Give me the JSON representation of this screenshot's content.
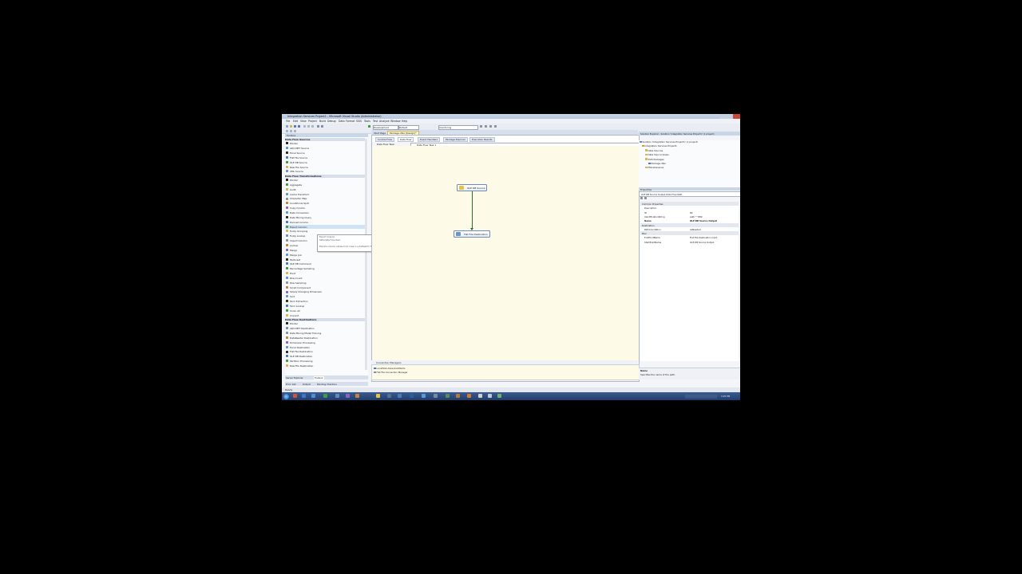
{
  "window": {
    "title": "Integration Services Project1 - Microsoft Visual Studio (Administrator)"
  },
  "menu": [
    "File",
    "Edit",
    "View",
    "Project",
    "Build",
    "Debug",
    "Data",
    "Format",
    "SSIS",
    "Tools",
    "Test",
    "Analyze",
    "Window",
    "Help"
  ],
  "toolbar": {
    "config": "Development",
    "platform": "Default",
    "find": "monitoring"
  },
  "toolbox": {
    "title": "Toolbox",
    "sources_header": "Data Flow Sources",
    "sources": [
      "Pointer",
      "ADO NET Source",
      "Excel Source",
      "Flat File Source",
      "OLE DB Source",
      "Raw File Source",
      "XML Source"
    ],
    "transforms_header": "Data Flow Transformations",
    "transforms": [
      "Pointer",
      "Aggregate",
      "Audit",
      "Cache Transform",
      "Character Map",
      "Conditional Split",
      "Copy Column",
      "Data Conversion",
      "Data Mining Query",
      "Derived Column",
      "Export Column",
      "Fuzzy Grouping",
      "Fuzzy Lookup",
      "Import Column",
      "Lookup",
      "Merge",
      "Merge Join",
      "Multicast",
      "OLE DB Command",
      "Percentage Sampling",
      "Pivot",
      "Row Count",
      "Row Sampling",
      "Script Component",
      "Slowly Changing Dimension",
      "Sort",
      "Term Extraction",
      "Term Lookup",
      "Union All",
      "Unpivot"
    ],
    "destinations_header": "Data Flow Destinations",
    "destinations": [
      "Pointer",
      "ADO NET Destination",
      "Data Mining Model Training",
      "DataReader Destination",
      "Dimension Processing",
      "Excel Destination",
      "Flat File Destination",
      "OLE DB Destination",
      "Partition Processing",
      "Raw File Destination"
    ],
    "bottom_tabs": [
      "Server Explorer",
      "Toolbox"
    ],
    "bottom_tabs2": [
      "Error List",
      "Output",
      "Pending Checkins"
    ]
  },
  "tooltip": {
    "title": "Export Column",
    "version": "SSIS Data Flow Item",
    "desc": "Exports column values from rows in a dataset to files."
  },
  "designer": {
    "doc_tabs": [
      "Start Page",
      "Package.dtsx [Design]*"
    ],
    "tabs": [
      "Control Flow",
      "Data Flow",
      "Event Handlers",
      "Package Explorer",
      "Execution Results"
    ],
    "task_label": "Data Flow Task:",
    "task_value": "Data Flow Task 1",
    "components": {
      "source": "OLE DB Source",
      "dest": "Flat File Destination"
    }
  },
  "connections": {
    "title": "Connection Managers",
    "items": [
      "LocalHost.AdventureWorks",
      "Flat File Connection Manager"
    ]
  },
  "solution": {
    "title": "Solution Explorer - Solution 'Integration Services Project1' (1 project)",
    "items": [
      "Solution 'Integration Services Project1' (1 project)",
      "Integration Services Project1",
      "Data Sources",
      "Data Source Views",
      "SSIS Packages",
      "Package.dtsx",
      "Miscellaneous"
    ]
  },
  "properties": {
    "title": "Properties",
    "object": "OLE DB Source Output  Data Flow Path",
    "rows": [
      [
        "Common Properties",
        ""
      ],
      [
        "Description",
        ""
      ],
      [
        "ID",
        "89"
      ],
      [
        "IdentificationString",
        "path \"\" 889"
      ],
      [
        "Name",
        "OLE DB Source Output"
      ],
      [
        "Destination",
        ""
      ],
      [
        "PathAnnotation",
        "AsNeeded"
      ],
      [
        "Misc",
        ""
      ],
      [
        "EndPointName",
        "Flat File Destination Input"
      ],
      [
        "StartPointName",
        "OLE DB Source Output"
      ]
    ],
    "help_title": "Name",
    "help_desc": "Specifies the name of the path."
  },
  "status": {
    "text": "Ready"
  },
  "taskbar": {
    "clock": "3:25 PM"
  }
}
